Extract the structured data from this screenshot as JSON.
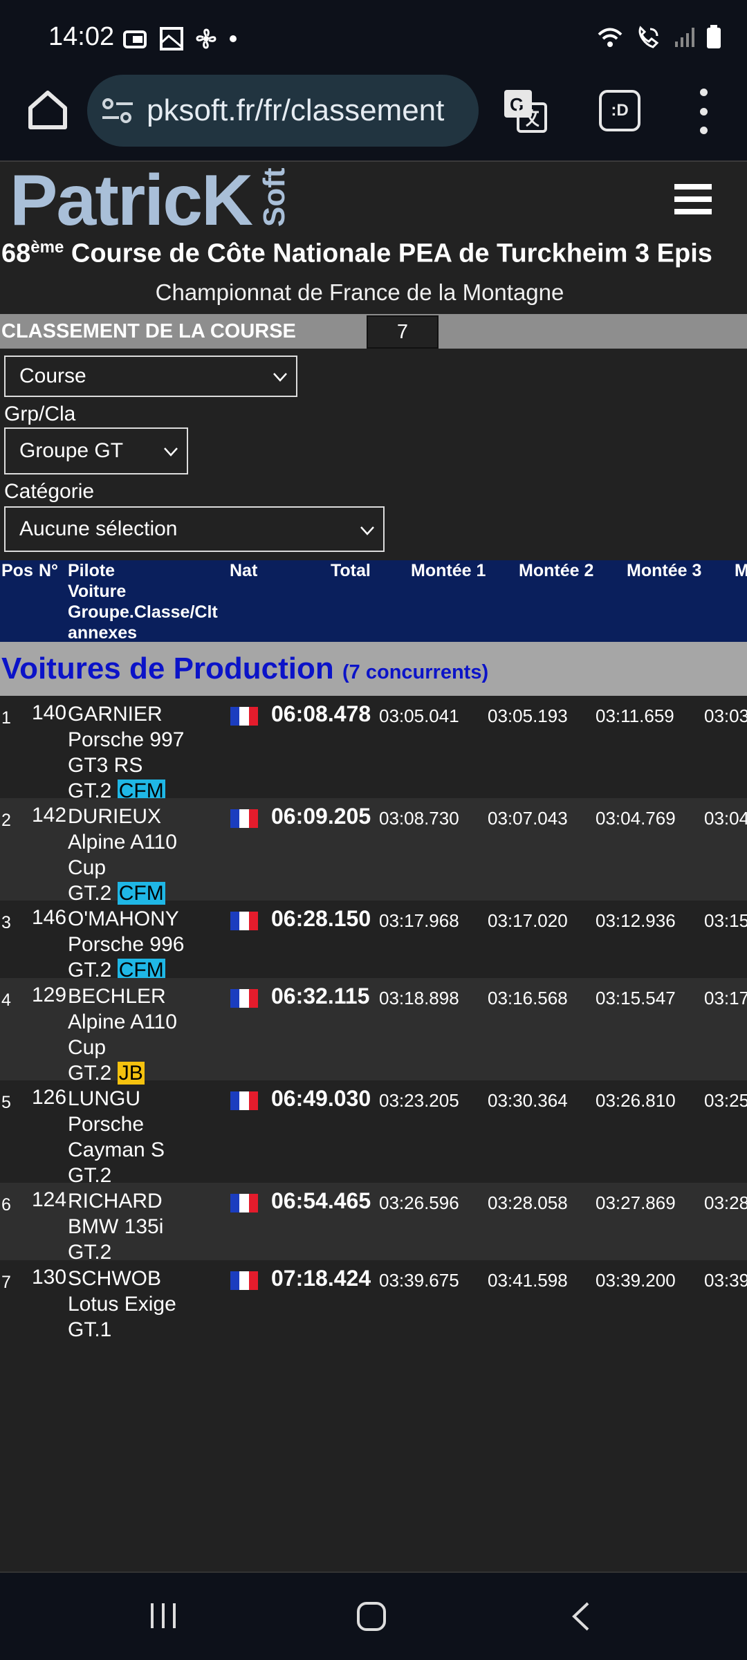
{
  "status_bar": {
    "time": "14:02"
  },
  "browser": {
    "url": "pksoft.fr/fr/classement",
    "tab_label": ":D"
  },
  "site": {
    "logo": "PatricK",
    "logo_suffix": "Soft",
    "event_prefix": "68",
    "event_sup": "ème",
    "event_title": " Course de Côte Nationale PEA de Turckheim 3 Epis",
    "subtitle": "Championnat de France de la Montagne",
    "classement_label": "CLASSEMENT DE LA COURSE",
    "classement_value": "7"
  },
  "filters": {
    "course_select": "Course",
    "grp_label": "Grp/Cla",
    "grp_select": "Groupe GT",
    "cat_label": "Catégorie",
    "cat_select": "Aucune sélection"
  },
  "table": {
    "headers": {
      "pos": "Pos",
      "num": "N°",
      "pilote": "Pilote",
      "voiture": "Voiture",
      "groupe": "Groupe.Classe/Clt",
      "annexes": "annexes",
      "nat": "Nat",
      "total": "Total",
      "m1": "Montée 1",
      "m2": "Montée 2",
      "m3": "Montée 3",
      "m4": "M"
    },
    "group_title": "Voitures de Production",
    "group_count": "(7 concurrents)",
    "rows": [
      {
        "pos": "1",
        "num": "140",
        "pilote": "GARNIER",
        "voiture1": "Porsche 997",
        "voiture2": "GT3 RS",
        "classe": "GT.2",
        "badge": "CFM",
        "total": "06:08.478",
        "m1": "03:05.041",
        "m2": "03:05.193",
        "m3": "03:11.659",
        "m4": "03:03"
      },
      {
        "pos": "2",
        "num": "142",
        "pilote": "DURIEUX",
        "voiture1": "Alpine A110",
        "voiture2": "Cup",
        "classe": "GT.2",
        "badge": "CFM",
        "total": "06:09.205",
        "m1": "03:08.730",
        "m2": "03:07.043",
        "m3": "03:04.769",
        "m4": "03:04"
      },
      {
        "pos": "3",
        "num": "146",
        "pilote": "O'MAHONY",
        "voiture1": "Porsche 996",
        "classe": "GT.2",
        "badge": "CFM",
        "total": "06:28.150",
        "m1": "03:17.968",
        "m2": "03:17.020",
        "m3": "03:12.936",
        "m4": "03:15"
      },
      {
        "pos": "4",
        "num": "129",
        "pilote": "BECHLER",
        "voiture1": "Alpine A110",
        "voiture2": "Cup",
        "classe": "GT.2",
        "badge": "JB",
        "total": "06:32.115",
        "m1": "03:18.898",
        "m2": "03:16.568",
        "m3": "03:15.547",
        "m4": "03:17"
      },
      {
        "pos": "5",
        "num": "126",
        "pilote": "LUNGU",
        "voiture1": "Porsche",
        "voiture2": "Cayman S",
        "classe": "GT.2",
        "total": "06:49.030",
        "m1": "03:23.205",
        "m2": "03:30.364",
        "m3": "03:26.810",
        "m4": "03:25"
      },
      {
        "pos": "6",
        "num": "124",
        "pilote": "RICHARD",
        "voiture1": "BMW 135i",
        "classe": "GT.2",
        "total": "06:54.465",
        "m1": "03:26.596",
        "m2": "03:28.058",
        "m3": "03:27.869",
        "m4": "03:28"
      },
      {
        "pos": "7",
        "num": "130",
        "pilote": "SCHWOB",
        "voiture1": "Lotus Exige",
        "classe": "GT.1",
        "total": "07:18.424",
        "m1": "03:39.675",
        "m2": "03:41.598",
        "m3": "03:39.200",
        "m4": "03:39"
      }
    ]
  },
  "colors": {
    "header_bg": "#0a1f5c",
    "group_title": "#0b13c8",
    "badge_cfm": "#1fb7e6",
    "badge_jb": "#f5c20f"
  }
}
